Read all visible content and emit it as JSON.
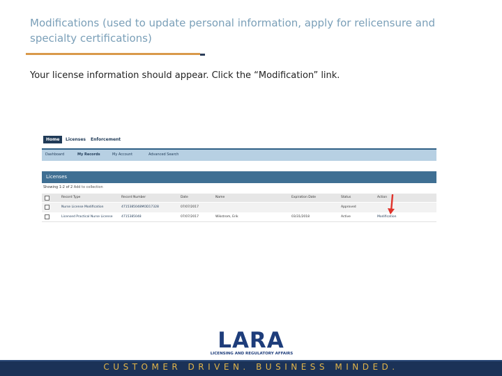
{
  "slide": {
    "title": "Modifications  (used to update personal information, apply for relicensure and specialty certifications)",
    "instruction": "Your license information should appear. Click the “Modification” link.",
    "footer": "CUSTOMER DRIVEN. BUSINESS MINDED.",
    "logo": {
      "text": "LARA",
      "subtitle": "LICENSING AND REGULATORY AFFAIRS"
    }
  },
  "screenshot": {
    "top_nav": [
      "Home",
      "Licenses",
      "Enforcement"
    ],
    "sub_nav": [
      "Dashboard",
      "My Records",
      "My Account",
      "Advanced Search"
    ],
    "section_title": "Licenses",
    "showing": "Showing 1-2 of 2",
    "add_to_collection": "Add to collection",
    "columns": [
      "Record Type",
      "Record Number",
      "Date",
      "Name",
      "Expiration Date",
      "Status",
      "Action"
    ],
    "rows": [
      {
        "record_type": "Nurse License Modification",
        "record_number": "4715385048MOD17328",
        "date": "07/07/2017",
        "name": "",
        "expiration_date": "",
        "status": "Approved",
        "action": ""
      },
      {
        "record_type": "Licensed Practical Nurse License",
        "record_number": "4715385048",
        "date": "07/07/2017",
        "name": "Wikstrom, Erik",
        "expiration_date": "03/31/2018",
        "status": "Active",
        "action": "Modification"
      }
    ],
    "arrow_color": "#e0332b"
  },
  "colors": {
    "title": "#7a9fb8",
    "rule_orange": "#d9994a",
    "footer_bg": "#1b3257",
    "footer_text": "#e2b54a",
    "logo": "#1e3d7b"
  }
}
